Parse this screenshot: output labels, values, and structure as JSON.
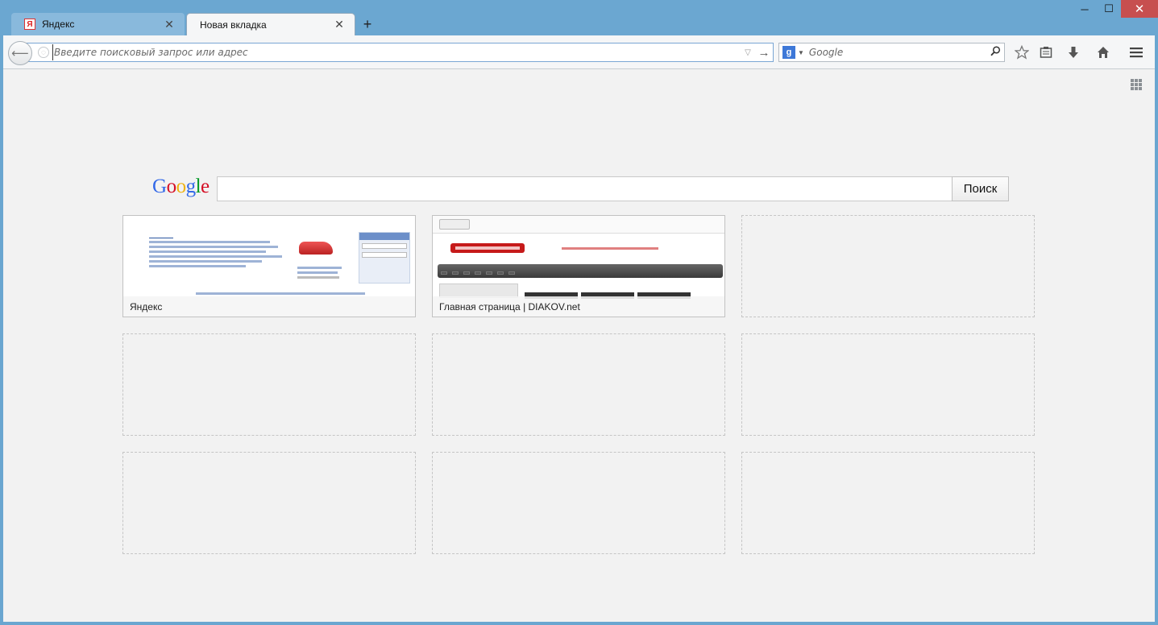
{
  "window": {
    "controls": {
      "minimize": "─",
      "maximize": "☐",
      "close": "✕"
    }
  },
  "tabs": [
    {
      "label": "Яндекс",
      "favicon": "Я",
      "active": false
    },
    {
      "label": "Новая вкладка",
      "active": true
    }
  ],
  "new_tab_symbol": "+",
  "tab_close_symbol": "✕",
  "navbar": {
    "back_symbol": "⟵",
    "url_placeholder": "Введите поисковый запрос или адрес",
    "url_value": "",
    "search_engine_letter": "g",
    "search_placeholder": "Google",
    "icons": [
      "star-icon",
      "reading-list-icon",
      "download-icon",
      "home-icon",
      "menu-icon"
    ]
  },
  "newtab": {
    "google_logo": [
      "G",
      "o",
      "o",
      "g",
      "l",
      "e"
    ],
    "search_button": "Поиск",
    "tiles": [
      {
        "title": "Яндекс",
        "filled": true
      },
      {
        "title": "Главная страница | DIAKOV.net",
        "filled": true
      },
      {
        "title": "",
        "filled": false
      },
      {
        "title": "",
        "filled": false
      },
      {
        "title": "",
        "filled": false
      },
      {
        "title": "",
        "filled": false
      },
      {
        "title": "",
        "filled": false
      },
      {
        "title": "",
        "filled": false
      },
      {
        "title": "",
        "filled": false
      }
    ]
  },
  "colors": {
    "frame": "#6ba7d1",
    "toolbar": "#f5f6f7",
    "content_bg": "#f2f2f2",
    "close_button": "#c74f4f"
  }
}
